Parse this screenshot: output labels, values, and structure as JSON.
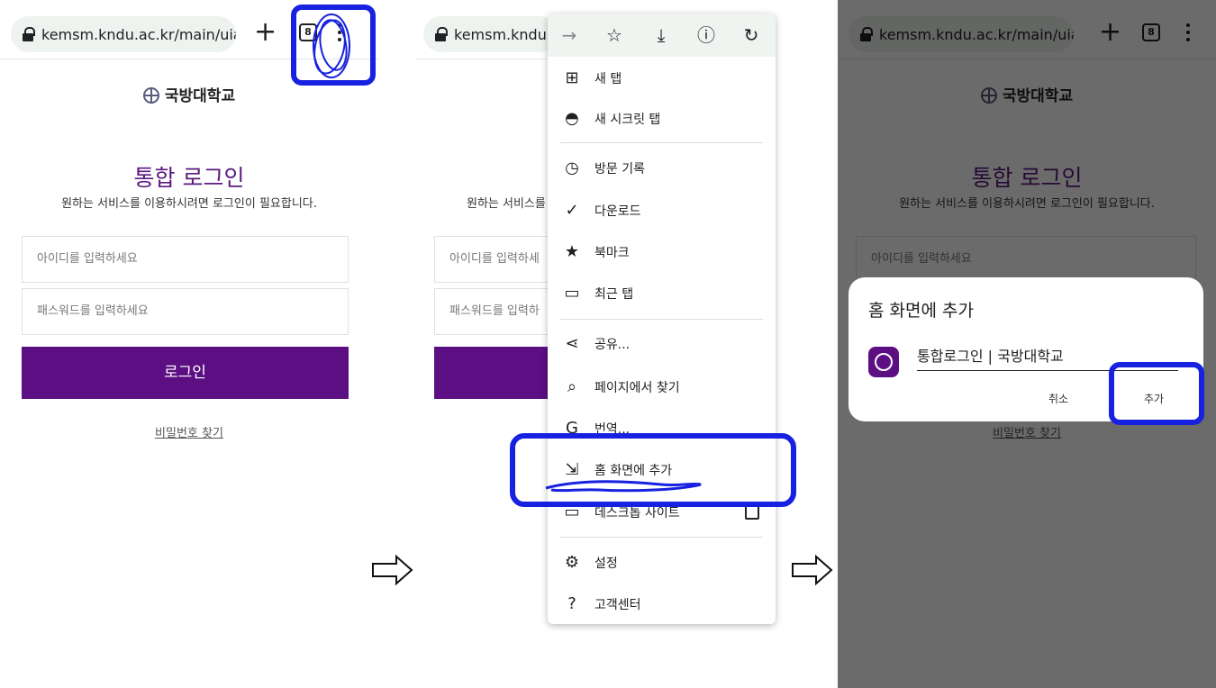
{
  "browser": {
    "url": "kemsm.kndu.ac.kr/main/uia/a",
    "url_truncated": "kemsm.kndu.a",
    "new_tab": "+",
    "tab_count": "8"
  },
  "page": {
    "brand": "국방대학교",
    "title": "통합 로그인",
    "subtitle": "원하는 서비스를 이용하시려면 로그인이 필요합니다.",
    "id_placeholder": "아이디를 입력하세요",
    "id_placeholder_short": "아이디를 입력하세",
    "pw_placeholder": "패스워드를 입력하세요",
    "pw_placeholder_short": "패스워드를 입력하",
    "login_button": "로그인",
    "find_password": "비밀번호 찾기"
  },
  "menu": {
    "items": [
      {
        "label": "새 탭",
        "icon": "new-tab-icon"
      },
      {
        "label": "새 시크릿 탭",
        "icon": "incognito-icon"
      },
      {
        "label": "방문 기록",
        "icon": "history-icon"
      },
      {
        "label": "다운로드",
        "icon": "downloads-icon"
      },
      {
        "label": "북마크",
        "icon": "star-icon"
      },
      {
        "label": "최근 탭",
        "icon": "devices-icon"
      },
      {
        "label": "공유...",
        "icon": "share-icon"
      },
      {
        "label": "페이지에서 찾기",
        "icon": "find-in-page-icon"
      },
      {
        "label": "번역...",
        "icon": "translate-icon"
      },
      {
        "label": "홈 화면에 추가",
        "icon": "add-to-home-icon"
      },
      {
        "label": "데스크톱 사이트",
        "icon": "desktop-icon"
      },
      {
        "label": "설정",
        "icon": "settings-icon"
      },
      {
        "label": "고객센터",
        "icon": "help-icon"
      }
    ]
  },
  "dialog": {
    "title": "홈 화면에 추가",
    "shortcut_name": "통합로그인 | 국방대학교",
    "cancel": "취소",
    "add": "추가"
  },
  "colors": {
    "brand_purple": "#5c0f83",
    "annotation_blue": "#1722e0"
  }
}
